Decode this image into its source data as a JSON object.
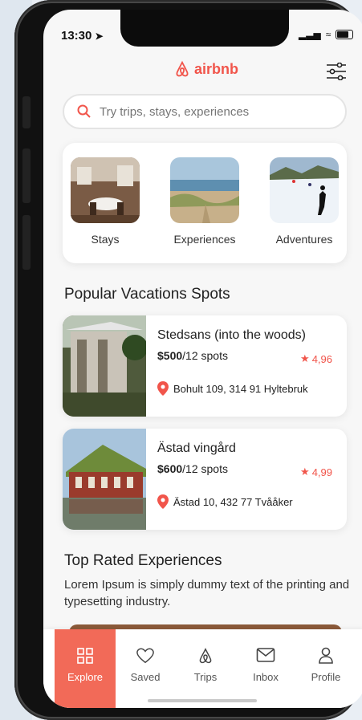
{
  "status": {
    "time": "13:30"
  },
  "brand": {
    "name": "airbnb",
    "color": "#f1554b"
  },
  "search": {
    "placeholder": "Try trips, stays, experiences"
  },
  "categories": [
    {
      "label": "Stays",
      "icon": "stays-photo"
    },
    {
      "label": "Experiences",
      "icon": "beach-photo"
    },
    {
      "label": "Adventures",
      "icon": "ski-photo"
    }
  ],
  "popular": {
    "title": "Popular Vacations Spots",
    "items": [
      {
        "name": "Stedsans (into the woods)",
        "price": "$500",
        "spots": "/12 spots",
        "rating": "4,96",
        "address": "Bohult 109, 314 91 Hyltebruk"
      },
      {
        "name": "Ästad vingård",
        "price": "$600",
        "spots": "/12 spots",
        "rating": "4,99",
        "address": "Ästad 10, 432 77 Tvååker"
      }
    ]
  },
  "experiences": {
    "title": "Top Rated Experiences",
    "description": "Lorem Ipsum is simply dummy text of the printing and typesetting industry."
  },
  "tabs": [
    {
      "label": "Explore",
      "icon": "explore-icon",
      "active": true
    },
    {
      "label": "Saved",
      "icon": "heart-icon",
      "active": false
    },
    {
      "label": "Trips",
      "icon": "airbnb-logo-icon",
      "active": false
    },
    {
      "label": "Inbox",
      "icon": "envelope-icon",
      "active": false
    },
    {
      "label": "Profile",
      "icon": "person-icon",
      "active": false
    }
  ],
  "colors": {
    "accent": "#f26a58",
    "rating": "#f1554b"
  }
}
